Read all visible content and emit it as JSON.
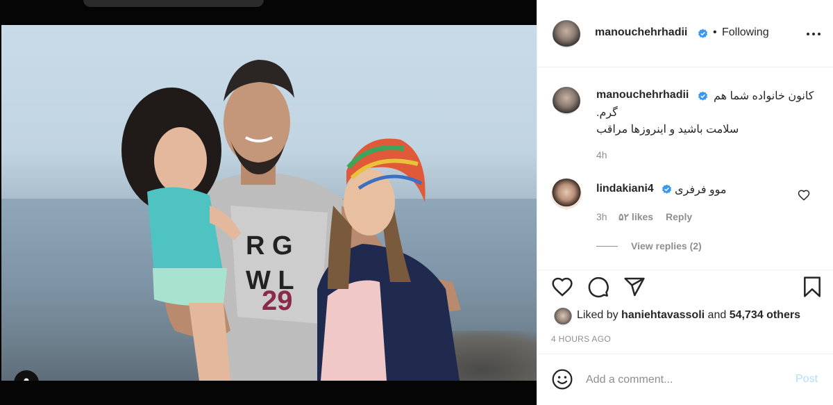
{
  "post": {
    "author": "manouchehrhadii",
    "follow_status": "Following",
    "separator": "•"
  },
  "caption": {
    "author": "manouchehrhadii",
    "line1": "کانون خانواده شما هم",
    "line2": "گرم.",
    "line3": "سلامت باشید و اینروزها مراقب",
    "time": "4h"
  },
  "comments": [
    {
      "author": "lindakiani4",
      "text": "موو فرفری",
      "time": "3h",
      "likes": "۵۲ likes",
      "reply_label": "Reply",
      "view_replies": "View replies (2)"
    }
  ],
  "likes_summary": {
    "prefix": "Liked by ",
    "user": "haniehtavassoli",
    "middle": " and ",
    "count": "54,734 others"
  },
  "timestamp": "4 HOURS AGO",
  "add_comment": {
    "placeholder": "Add a comment...",
    "post_label": "Post"
  },
  "colors": {
    "verified": "#3897f0",
    "post_disabled": "#b3dbff",
    "muted": "#8e8e8e",
    "text": "#262626"
  },
  "icons": [
    "user-tag-icon",
    "more-options-icon",
    "verified-icon",
    "heart-icon",
    "comment-icon",
    "share-icon",
    "bookmark-icon",
    "smiley-icon"
  ]
}
